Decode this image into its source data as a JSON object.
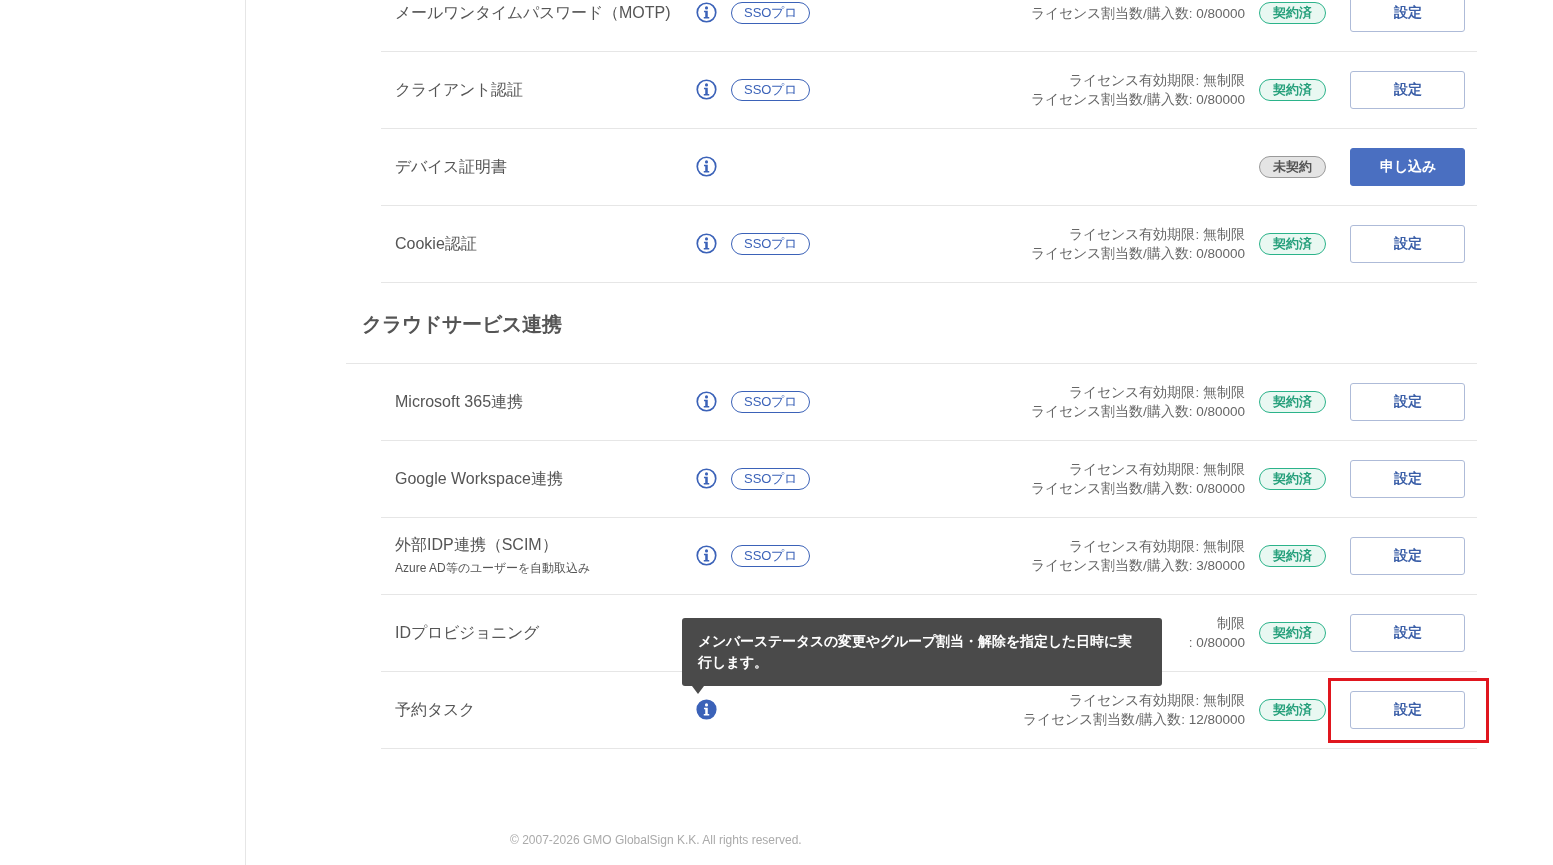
{
  "sections": [
    {
      "rows": [
        {
          "name": "メールワンタイムパスワード（MOTP)",
          "info_active": false,
          "plan": "SSOプロ",
          "license": [
            "ライセンス割当数/購入数: 0/80000"
          ],
          "status": {
            "kind": "contracted",
            "label": "契約済"
          },
          "button": {
            "kind": "settings",
            "label": "設定"
          }
        },
        {
          "name": "クライアント認証",
          "info_active": false,
          "plan": "SSOプロ",
          "license": [
            "ライセンス有効期限: 無制限",
            "ライセンス割当数/購入数: 0/80000"
          ],
          "status": {
            "kind": "contracted",
            "label": "契約済"
          },
          "button": {
            "kind": "settings",
            "label": "設定"
          }
        },
        {
          "name": "デバイス証明書",
          "info_active": false,
          "status": {
            "kind": "uncontracted",
            "label": "未契約"
          },
          "button": {
            "kind": "apply",
            "label": "申し込み"
          }
        },
        {
          "name": "Cookie認証",
          "info_active": false,
          "plan": "SSOプロ",
          "license": [
            "ライセンス有効期限: 無制限",
            "ライセンス割当数/購入数: 0/80000"
          ],
          "status": {
            "kind": "contracted",
            "label": "契約済"
          },
          "button": {
            "kind": "settings",
            "label": "設定"
          }
        }
      ]
    },
    {
      "title": "クラウドサービス連携",
      "rows": [
        {
          "name": "Microsoft 365連携",
          "info_active": false,
          "plan": "SSOプロ",
          "license": [
            "ライセンス有効期限: 無制限",
            "ライセンス割当数/購入数: 0/80000"
          ],
          "status": {
            "kind": "contracted",
            "label": "契約済"
          },
          "button": {
            "kind": "settings",
            "label": "設定"
          }
        },
        {
          "name": "Google Workspace連携",
          "info_active": false,
          "plan": "SSOプロ",
          "license": [
            "ライセンス有効期限: 無制限",
            "ライセンス割当数/購入数: 0/80000"
          ],
          "status": {
            "kind": "contracted",
            "label": "契約済"
          },
          "button": {
            "kind": "settings",
            "label": "設定"
          }
        },
        {
          "name": "外部IDP連携（SCIM）",
          "subtitle": "Azure AD等のユーザーを自動取込み",
          "info_active": false,
          "plan": "SSOプロ",
          "license": [
            "ライセンス有効期限: 無制限",
            "ライセンス割当数/購入数: 3/80000"
          ],
          "status": {
            "kind": "contracted",
            "label": "契約済"
          },
          "button": {
            "kind": "settings",
            "label": "設定"
          }
        },
        {
          "name": "IDプロビジョニング",
          "license": [
            "制限",
            ": 0/80000"
          ],
          "status": {
            "kind": "contracted",
            "label": "契約済"
          },
          "button": {
            "kind": "settings",
            "label": "設定"
          }
        },
        {
          "name": "予約タスク",
          "info_active": true,
          "tooltip": "メンバーステータスの変更やグループ割当・解除を指定した日時に実行します。",
          "license": [
            "ライセンス有効期限: 無制限",
            "ライセンス割当数/購入数: 12/80000"
          ],
          "status": {
            "kind": "contracted",
            "label": "契約済"
          },
          "button": {
            "kind": "settings",
            "label": "設定",
            "highlighted": true
          }
        }
      ]
    }
  ],
  "footer": "© 2007-2026 GMO GlobalSign K.K. All rights reserved."
}
